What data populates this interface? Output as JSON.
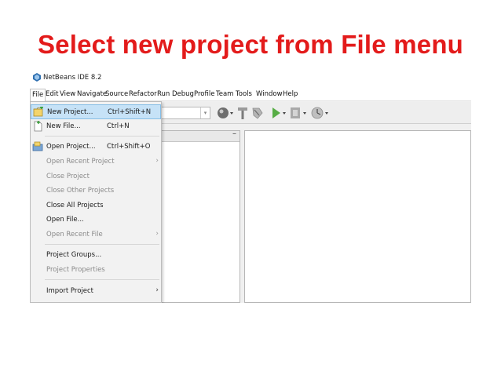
{
  "slide": {
    "title": "Select new project from File menu"
  },
  "window": {
    "title": "NetBeans IDE 8.2"
  },
  "menubar": [
    {
      "id": "file",
      "label": "File"
    },
    {
      "id": "edit",
      "label": "Edit"
    },
    {
      "id": "view",
      "label": "View"
    },
    {
      "id": "navigate",
      "label": "Navigate"
    },
    {
      "id": "source",
      "label": "Source"
    },
    {
      "id": "refactor",
      "label": "Refactor"
    },
    {
      "id": "run",
      "label": "Run"
    },
    {
      "id": "debug",
      "label": "Debug"
    },
    {
      "id": "profile",
      "label": "Profile"
    },
    {
      "id": "team",
      "label": "Team"
    },
    {
      "id": "tools",
      "label": "Tools"
    },
    {
      "id": "window",
      "label": "Window"
    },
    {
      "id": "help",
      "label": "Help"
    }
  ],
  "file_menu": {
    "items": [
      {
        "label": "New Project...",
        "shortcut": "Ctrl+Shift+N",
        "enabled": true,
        "highlighted": true,
        "icon": "new-project-icon"
      },
      {
        "label": "New File...",
        "shortcut": "Ctrl+N",
        "enabled": true,
        "icon": "new-file-icon"
      },
      {
        "label": "Open Project...",
        "shortcut": "Ctrl+Shift+O",
        "enabled": true,
        "icon": "open-project-icon"
      },
      {
        "label": "Open Recent Project",
        "shortcut": "",
        "enabled": false,
        "submenu": true
      },
      {
        "label": "Close Project",
        "shortcut": "",
        "enabled": false
      },
      {
        "label": "Close Other Projects",
        "shortcut": "",
        "enabled": false
      },
      {
        "label": "Close All Projects",
        "shortcut": "",
        "enabled": true
      },
      {
        "label": "Open File...",
        "shortcut": "",
        "enabled": true
      },
      {
        "label": "Open Recent File",
        "shortcut": "",
        "enabled": false,
        "submenu": true
      },
      {
        "label": "Project Groups...",
        "shortcut": "",
        "enabled": true
      },
      {
        "label": "Project Properties",
        "shortcut": "",
        "enabled": false
      },
      {
        "label": "Import Project",
        "shortcut": "",
        "enabled": true,
        "submenu": true
      }
    ]
  },
  "colors": {
    "slide_title": "#e31b1b",
    "menu_highlight": "#c6e2f7",
    "disabled_text": "#8a8a8a"
  }
}
